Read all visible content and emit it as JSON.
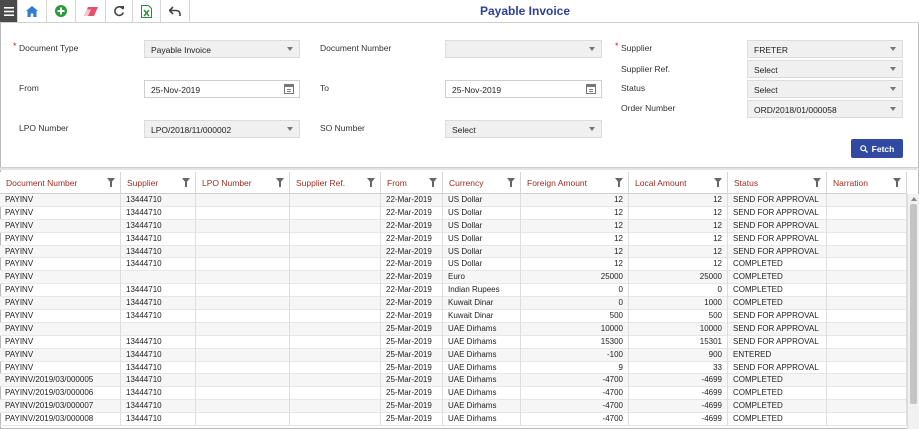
{
  "title": "Payable Invoice",
  "toolbar": {
    "icons": [
      "menu-icon",
      "home-icon",
      "add-icon",
      "eraser-icon",
      "refresh-icon",
      "excel-icon",
      "undo-icon"
    ]
  },
  "form": {
    "document_type": {
      "label": "Document Type",
      "value": "Payable Invoice",
      "required": true
    },
    "document_number": {
      "label": "Document Number",
      "value": ""
    },
    "supplier": {
      "label": "Supplier",
      "value": "FRETER",
      "required": true
    },
    "supplier_ref": {
      "label": "Supplier Ref.",
      "value": "Select"
    },
    "from": {
      "label": "From",
      "value": "25-Nov-2019"
    },
    "to": {
      "label": "To",
      "value": "25-Nov-2019"
    },
    "status": {
      "label": "Status",
      "value": "Select"
    },
    "order_number": {
      "label": "Order Number",
      "value": "ORD/2018/01/000058"
    },
    "lpo_number": {
      "label": "LPO Number",
      "value": "LPO/2018/11/000002"
    },
    "so_number": {
      "label": "SO Number",
      "value": "Select"
    },
    "fetch_label": "Fetch"
  },
  "grid": {
    "columns": [
      "Document Number",
      "Supplier",
      "LPO Number",
      "Supplier Ref.",
      "From",
      "Currency",
      "Foreign Amount",
      "Local Amount",
      "Status",
      "Narration"
    ],
    "rows": [
      [
        "PAYINV",
        "13444710",
        "",
        "",
        "22-Mar-2019",
        "US Dollar",
        "12",
        "12",
        "SEND FOR APPROVAL",
        ""
      ],
      [
        "PAYINV",
        "13444710",
        "",
        "",
        "22-Mar-2019",
        "US Dollar",
        "12",
        "12",
        "SEND FOR APPROVAL",
        ""
      ],
      [
        "PAYINV",
        "13444710",
        "",
        "",
        "22-Mar-2019",
        "US Dollar",
        "12",
        "12",
        "SEND FOR APPROVAL",
        ""
      ],
      [
        "PAYINV",
        "13444710",
        "",
        "",
        "22-Mar-2019",
        "US Dollar",
        "12",
        "12",
        "SEND FOR APPROVAL",
        ""
      ],
      [
        "PAYINV",
        "13444710",
        "",
        "",
        "22-Mar-2019",
        "US Dollar",
        "12",
        "12",
        "SEND FOR APPROVAL",
        ""
      ],
      [
        "PAYINV",
        "13444710",
        "",
        "",
        "22-Mar-2019",
        "US Dollar",
        "12",
        "12",
        "COMPLETED",
        ""
      ],
      [
        "PAYINV",
        "",
        "",
        "",
        "22-Mar-2019",
        "Euro",
        "25000",
        "25000",
        "COMPLETED",
        ""
      ],
      [
        "PAYINV",
        "13444710",
        "",
        "",
        "22-Mar-2019",
        "Indian Rupees",
        "0",
        "0",
        "COMPLETED",
        ""
      ],
      [
        "PAYINV",
        "13444710",
        "",
        "",
        "22-Mar-2019",
        "Kuwait Dinar",
        "0",
        "1000",
        "COMPLETED",
        ""
      ],
      [
        "PAYINV",
        "13444710",
        "",
        "",
        "22-Mar-2019",
        "Kuwait Dinar",
        "500",
        "500",
        "SEND FOR APPROVAL",
        ""
      ],
      [
        "PAYINV",
        "",
        "",
        "",
        "25-Mar-2019",
        "UAE Dirhams",
        "10000",
        "10000",
        "SEND FOR APPROVAL",
        ""
      ],
      [
        "PAYINV",
        "13444710",
        "",
        "",
        "25-Mar-2019",
        "UAE Dirhams",
        "15300",
        "15301",
        "SEND FOR APPROVAL",
        ""
      ],
      [
        "PAYINV",
        "13444710",
        "",
        "",
        "25-Mar-2019",
        "UAE Dirhams",
        "-100",
        "900",
        "ENTERED",
        ""
      ],
      [
        "PAYINV",
        "13444710",
        "",
        "",
        "25-Mar-2019",
        "UAE Dirhams",
        "9",
        "33",
        "SEND FOR APPROVAL",
        ""
      ],
      [
        "PAYINV/2019/03/000005",
        "13444710",
        "",
        "",
        "25-Mar-2019",
        "UAE Dirhams",
        "-4700",
        "-4699",
        "COMPLETED",
        ""
      ],
      [
        "PAYINV/2019/03/000006",
        "13444710",
        "",
        "",
        "25-Mar-2019",
        "UAE Dirhams",
        "-4700",
        "-4699",
        "COMPLETED",
        ""
      ],
      [
        "PAYINV/2019/03/000007",
        "13444710",
        "",
        "",
        "25-Mar-2019",
        "UAE Dirhams",
        "-4700",
        "-4699",
        "COMPLETED",
        ""
      ],
      [
        "PAYINV/2019/03/000008",
        "13444710",
        "",
        "",
        "25-Mar-2019",
        "UAE Dirhams",
        "-4700",
        "-4699",
        "COMPLETED",
        ""
      ]
    ]
  },
  "colors": {
    "title": "#2c3f9a",
    "header_text": "#9a2e20",
    "fetch_button": "#2f4aa0",
    "required": "#d62020"
  }
}
